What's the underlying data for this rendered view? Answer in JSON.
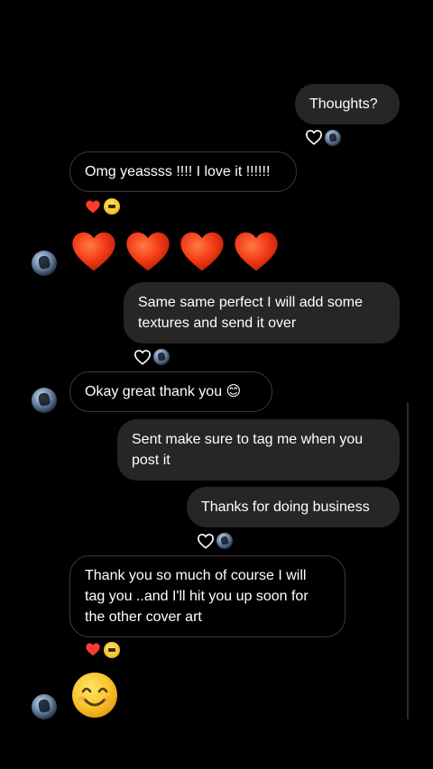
{
  "messages": {
    "m1": "Thoughts?",
    "m2": "Omg yeassss !!!! I love it !!!!!!",
    "m3_line1": "Same same perfect I will add some",
    "m3_line2": "textures and send it over",
    "m4": "Okay great thank you 😊",
    "m5_line1": "Sent make sure to tag me when you",
    "m5_line2": "post it",
    "m6": "Thanks for doing business",
    "m7_line1": "Thank you so much of course I will",
    "m7_line2": "tag you ..and I'll hit you up soon for",
    "m7_line3": "the other cover art"
  },
  "emoji_messages": {
    "hearts": [
      "red-heart",
      "red-heart",
      "red-heart",
      "red-heart"
    ],
    "smile": "smiling-face"
  },
  "icons": {
    "outline_heart": "heart-outline-icon",
    "reaction_heart": "red-heart-icon",
    "sticker": "sticker-icon",
    "avatar": "profile-avatar"
  },
  "colors": {
    "background": "#000000",
    "outgoing_bubble": "#262626",
    "incoming_border": "#3a3a3a",
    "heart_red": "#ff3b30",
    "text": "#ffffff"
  }
}
